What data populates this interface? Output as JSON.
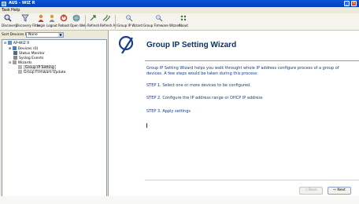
{
  "window": {
    "title": "AUS - WIZ R"
  },
  "menu": {
    "items": [
      "Task",
      "Help"
    ]
  },
  "toolbar": {
    "buttons": [
      {
        "label": "Discovery",
        "icon": "magnifier-icon"
      },
      {
        "label": "Discovery Filter",
        "icon": "filter-icon"
      },
      {
        "label": "Login",
        "icon": "login-icon"
      },
      {
        "label": "Logout",
        "icon": "logout-icon"
      },
      {
        "label": "Reboot",
        "icon": "reboot-icon"
      },
      {
        "label": "Open Web",
        "icon": "globe-icon"
      },
      {
        "label": "Refresh",
        "icon": "refresh-icon"
      },
      {
        "label": "Refresh All",
        "icon": "refresh-all-icon"
      },
      {
        "label": "Group IP Wizard",
        "icon": "wand-icon"
      },
      {
        "label": "Group Firmware Wizard",
        "icon": "wand-icon"
      },
      {
        "label": "About",
        "icon": "about-icon"
      }
    ]
  },
  "left_panel": {
    "sort_label": "Sort Devices By",
    "sort_value": "None",
    "tree": [
      {
        "label": "AP-WIZ R",
        "icon": "computer-icon"
      },
      {
        "label": "Devices (0)",
        "icon": "devices-icon"
      },
      {
        "label": "Status Monitor",
        "icon": "monitor-icon"
      },
      {
        "label": "Syslog Events",
        "icon": "log-icon"
      },
      {
        "label": "Wizards",
        "icon": "wand-icon"
      },
      {
        "label": "Group IP Setting",
        "icon": "wand-icon"
      },
      {
        "label": "Group Firmware Update",
        "icon": "wand-icon"
      }
    ]
  },
  "wizard": {
    "title": "Group IP Setting Wizard",
    "intro": "Group IP Setting Wizard helps you walk throught whole IP address configure process of a group of devices. A few steps would be taken during this process:",
    "step1": "STEP 1. Select one or more devices to be configured.",
    "step2": "STEP 2. Configure the IP address range or DHCP IP address",
    "step3": "STEP 3. Apply settings",
    "back_label": "◁ Back",
    "next_label": "Next"
  },
  "colors": {
    "title_bar": "#0a55d8",
    "title_text": "#0a3170",
    "body_text": "#123a8a"
  }
}
